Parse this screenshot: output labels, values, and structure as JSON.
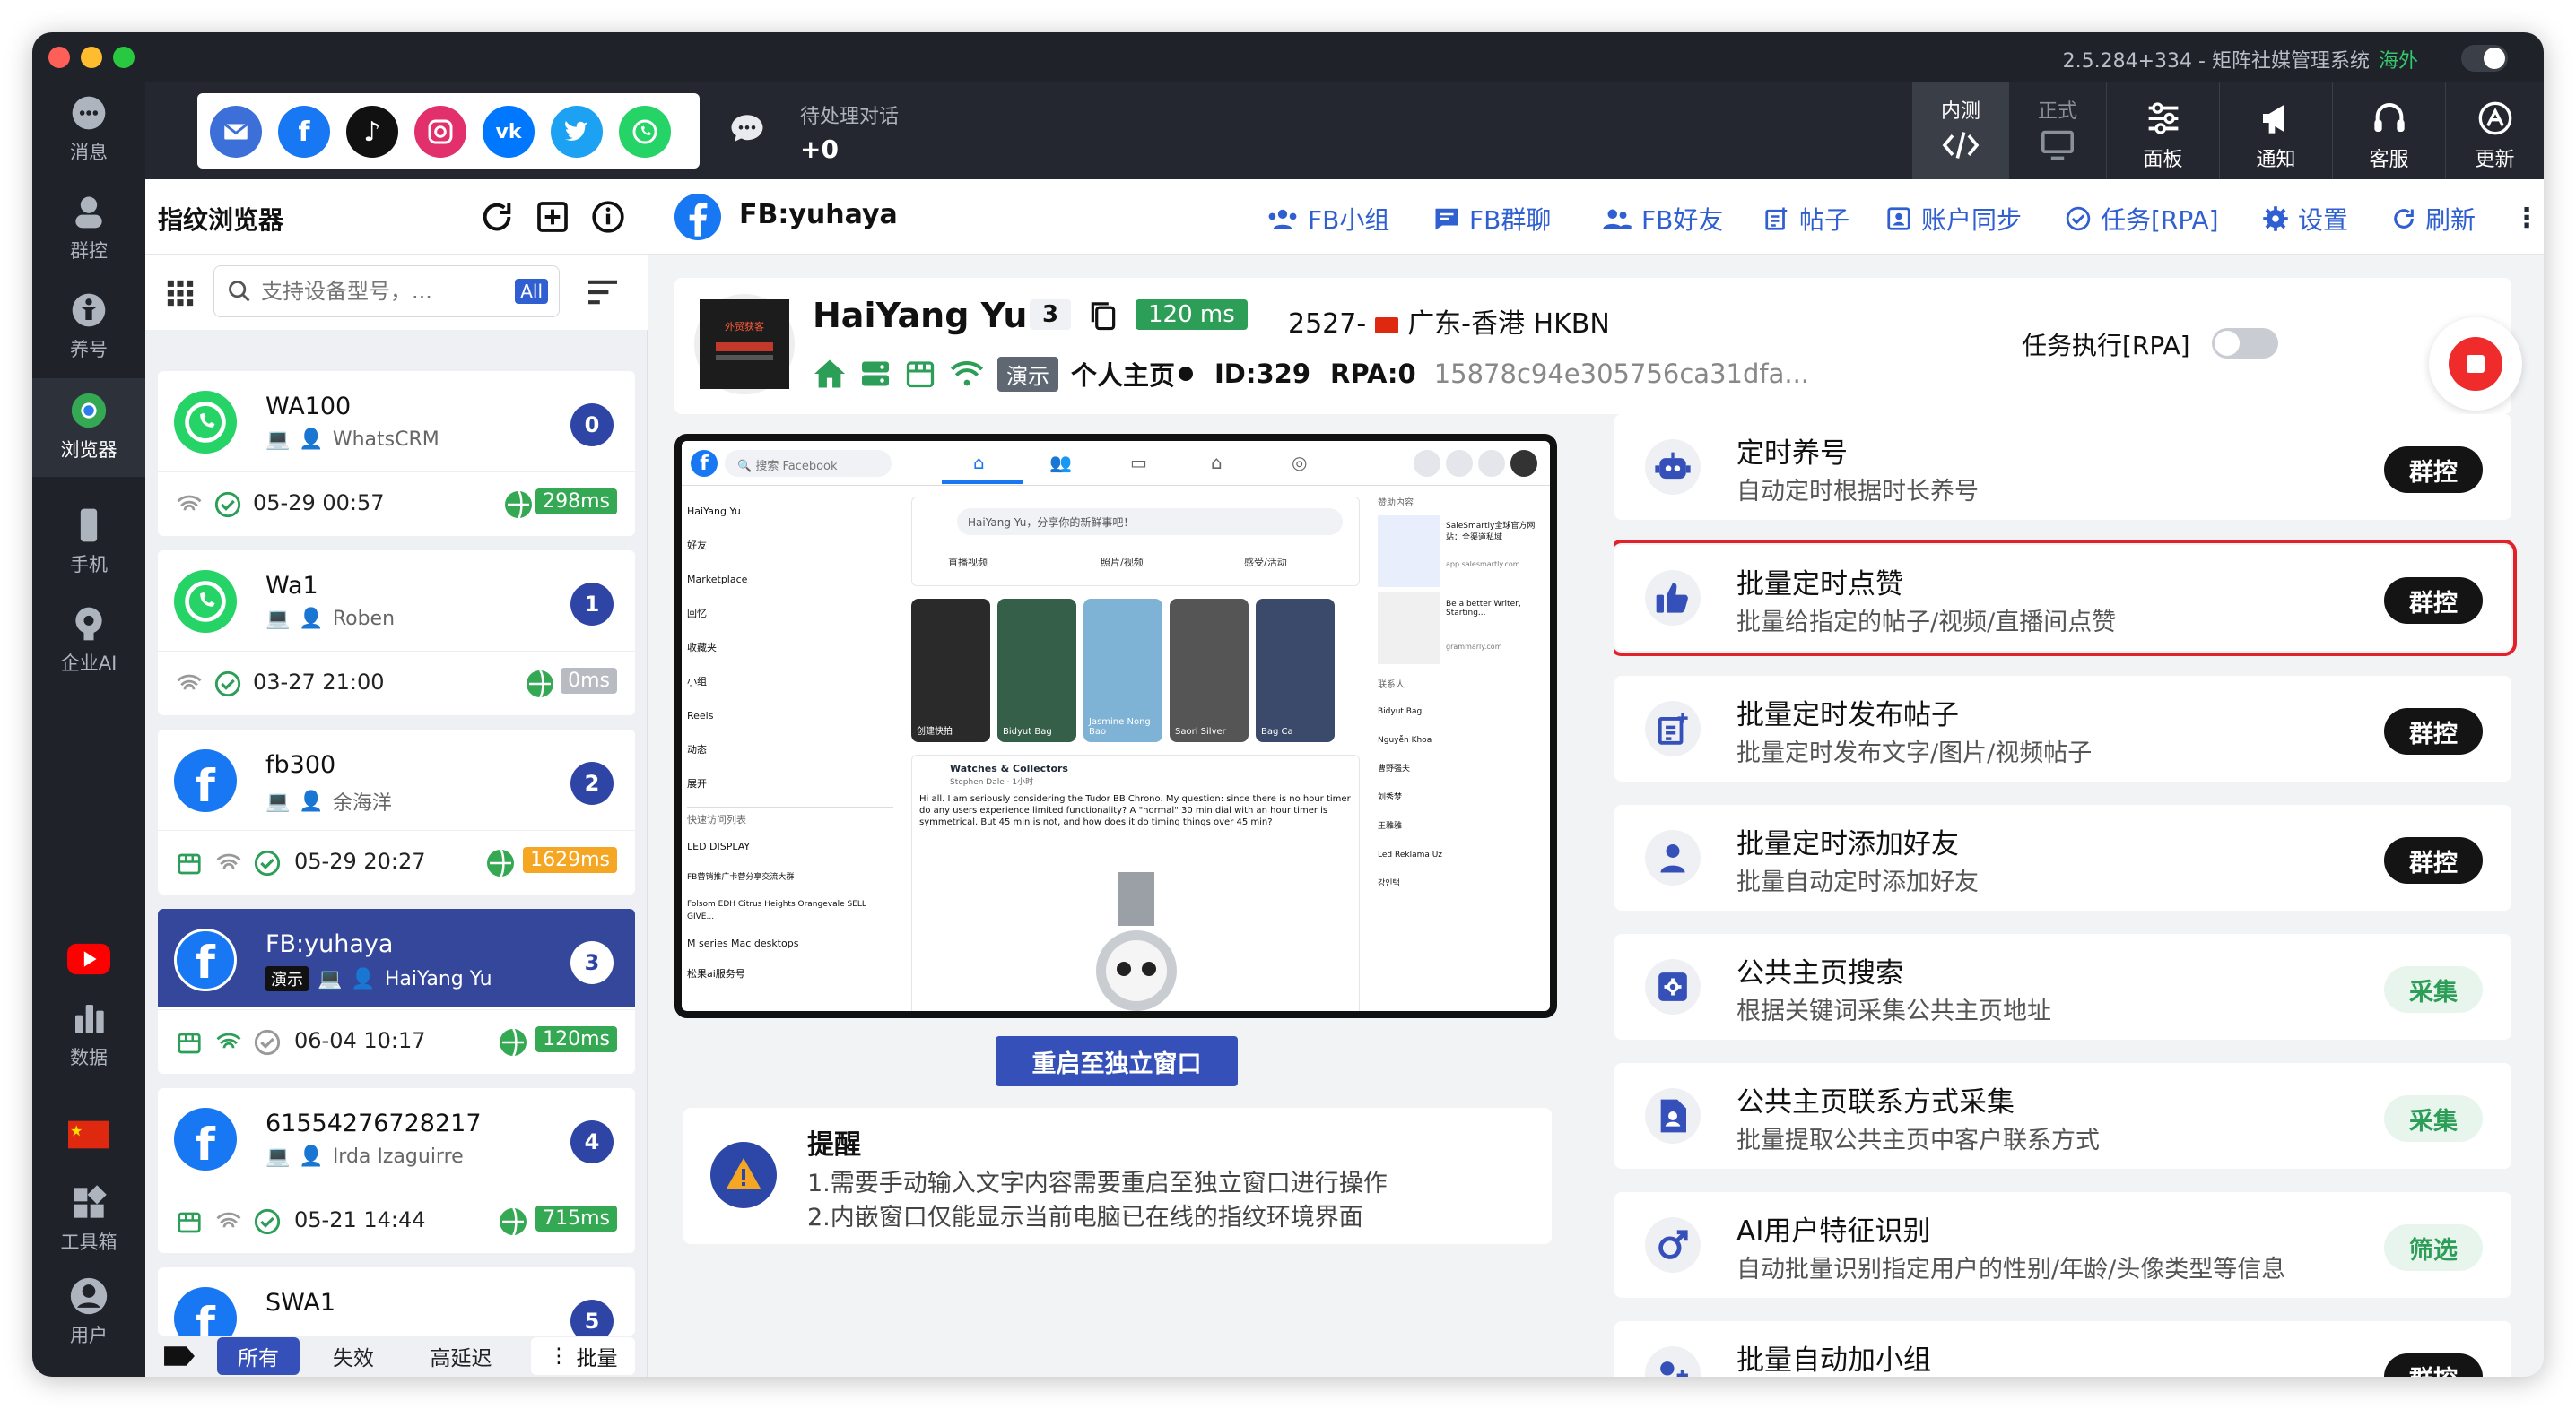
{
  "titlebar": {
    "version_title": "2.5.284+334 - 矩阵社媒管理系统",
    "region": "海外"
  },
  "leftnav": {
    "items": [
      {
        "label": "消息",
        "icon": "chat-icon"
      },
      {
        "label": "群控",
        "icon": "group-control-icon"
      },
      {
        "label": "养号",
        "icon": "nurture-icon"
      },
      {
        "label": "浏览器",
        "icon": "browser-icon"
      },
      {
        "label": "手机",
        "icon": "phone-icon"
      },
      {
        "label": "企业AI",
        "icon": "ai-brain-icon"
      },
      {
        "label": "数据",
        "icon": "bar-chart-icon"
      },
      {
        "label": "工具箱",
        "icon": "toolbox-icon"
      },
      {
        "label": "用户",
        "icon": "user-icon"
      }
    ],
    "active": "浏览器"
  },
  "topbar": {
    "pending_label": "待处理对话",
    "pending_count": "+0",
    "seg_beta": "内测",
    "seg_prod": "正式",
    "buttons": [
      {
        "label": "面板",
        "icon": "sliders-icon"
      },
      {
        "label": "通知",
        "icon": "megaphone-icon"
      },
      {
        "label": "客服",
        "icon": "headset-icon"
      },
      {
        "label": "更新",
        "icon": "update-icon"
      }
    ],
    "socials": [
      "email",
      "facebook",
      "tiktok",
      "instagram",
      "vk",
      "twitter",
      "whatsapp"
    ]
  },
  "sidebar": {
    "title": "指纹浏览器",
    "search_placeholder": "支持设备型号，...",
    "search_badge": "All",
    "cards": [
      {
        "name": "WA100",
        "owner": "WhatsCRM",
        "num": "0",
        "time": "05-29 00:57",
        "ms": "298ms",
        "ms_color": "#34a853",
        "type": "whatsapp"
      },
      {
        "name": "Wa1",
        "owner": "Roben",
        "num": "1",
        "time": "03-27 21:00",
        "ms": "0ms",
        "ms_color": "#b8bcc2",
        "type": "whatsapp"
      },
      {
        "name": "fb300",
        "owner": "余海洋",
        "num": "2",
        "time": "05-29 20:27",
        "ms": "1629ms",
        "ms_color": "#f5a623",
        "type": "facebook"
      },
      {
        "name": "FB:yuhaya",
        "owner": "HaiYang Yu",
        "tag": "演示",
        "num": "3",
        "time": "06-04 10:17",
        "ms": "120ms",
        "ms_color": "#34a853",
        "type": "facebook",
        "selected": true
      },
      {
        "name": "61554276728217",
        "owner": "Irda Izaguirre",
        "num": "4",
        "time": "05-21 14:44",
        "ms": "715ms",
        "ms_color": "#34a853",
        "type": "facebook"
      },
      {
        "name": "SWA1",
        "num": "5",
        "type": "facebook"
      }
    ],
    "footer": {
      "all": "所有",
      "invalid": "失效",
      "high_latency": "高延迟",
      "batch": "批量"
    }
  },
  "main": {
    "title": "FB:yuhaya",
    "links": [
      "FB小组",
      "FB群聊",
      "FB好友",
      "帖子",
      "账户同步",
      "任务[RPA]",
      "设置",
      "刷新"
    ],
    "profile": {
      "name": "HaiYang Yu",
      "count": "3",
      "latency": "120 ms",
      "location": "2527-",
      "region": "广东-香港 HKBN",
      "demo": "演示",
      "homepage": "个人主页",
      "id": "ID:329",
      "rpa": "RPA:0",
      "hash": "15878c94e305756ca31dfa..."
    },
    "rpa_label": "任务执行[RPA]",
    "restart_label": "重启至独立窗口",
    "notice": {
      "title": "提醒",
      "line1": "1.需要手动输入文字内容需要重启至独立窗口进行操作",
      "line2": "2.内嵌窗口仅能显示当前电脑已在线的指纹环境界面"
    },
    "tasks": [
      {
        "name": "定时养号",
        "desc": "自动定时根据时长养号",
        "btn": "群控",
        "style": "dark",
        "icon": "robot-icon"
      },
      {
        "name": "批量定时点赞",
        "desc": "批量给指定的帖子/视频/直播间点赞",
        "btn": "群控",
        "style": "dark",
        "icon": "thumbs-up-icon",
        "highlight": true
      },
      {
        "name": "批量定时发布帖子",
        "desc": "批量定时发布文字/图片/视频帖子",
        "btn": "群控",
        "style": "dark",
        "icon": "post-icon"
      },
      {
        "name": "批量定时添加好友",
        "desc": "批量自动定时添加好友",
        "btn": "群控",
        "style": "dark",
        "icon": "person-icon"
      },
      {
        "name": "公共主页搜索",
        "desc": "根据关键词采集公共主页地址",
        "btn": "采集",
        "style": "light",
        "icon": "search-page-icon"
      },
      {
        "name": "公共主页联系方式采集",
        "desc": "批量提取公共主页中客户联系方式",
        "btn": "采集",
        "style": "light",
        "icon": "contact-file-icon"
      },
      {
        "name": "AI用户特征识别",
        "desc": "自动批量识别指定用户的性别/年龄/头像类型等信息",
        "btn": "筛选",
        "style": "light",
        "icon": "gender-icon"
      },
      {
        "name": "批量自动加小组",
        "desc": "",
        "btn": "群控",
        "style": "dark",
        "icon": "group-add-icon"
      }
    ]
  },
  "preview": {
    "search": "搜索 Facebook",
    "user": "HaiYang Yu",
    "post_prompt": "HaiYang Yu，分享你的新鲜事吧！",
    "actions": [
      "直播视频",
      "照片/视频",
      "感受/活动"
    ],
    "left_menu": [
      "HaiYang Yu",
      "好友",
      "Marketplace",
      "回忆",
      "收藏夹",
      "小组",
      "Reels",
      "动态",
      "展开"
    ],
    "shortcuts_title": "快速访问列表",
    "shortcuts": [
      "LED DISPLAY",
      "FB营销推广卡营分享交流大群",
      "Folsom EDH Citrus Heights Orangevale SELL GIVE...",
      "M series Mac desktops",
      "松果ai服务号"
    ],
    "stories": [
      "创建快拍",
      "Bidyut Bag",
      "Jasmine Nong Bao",
      "Saori Silver",
      "Bag Ca"
    ],
    "post_author": "Watches & Collectors",
    "post_sub": "Stephen Dale · 1小时",
    "post_text": "Hi all.  I am seriously considering the Tudor BB Chrono.  My question:  since there is no hour timer do any users experience limited functionality? A \"normal\" 30 min dial with an hour timer is symmetrical.  But 45 min is not, and how does it do timing things over 45 min?",
    "sponsored": "赞助内容",
    "ad1": "SaleSmartly全球官方网站：全渠道私域",
    "ad1_url": "app.salesmartly.com",
    "ad2": "Be a better Writer, Starting...",
    "ad2_url": "grammarly.com",
    "contacts_title": "联系人",
    "contacts": [
      "Bidyut Bag",
      "Nguyễn Khoa",
      "曹野强夫",
      "刘秀梦",
      "王雅雅",
      "Led Reklama Uz",
      "강인택"
    ]
  }
}
